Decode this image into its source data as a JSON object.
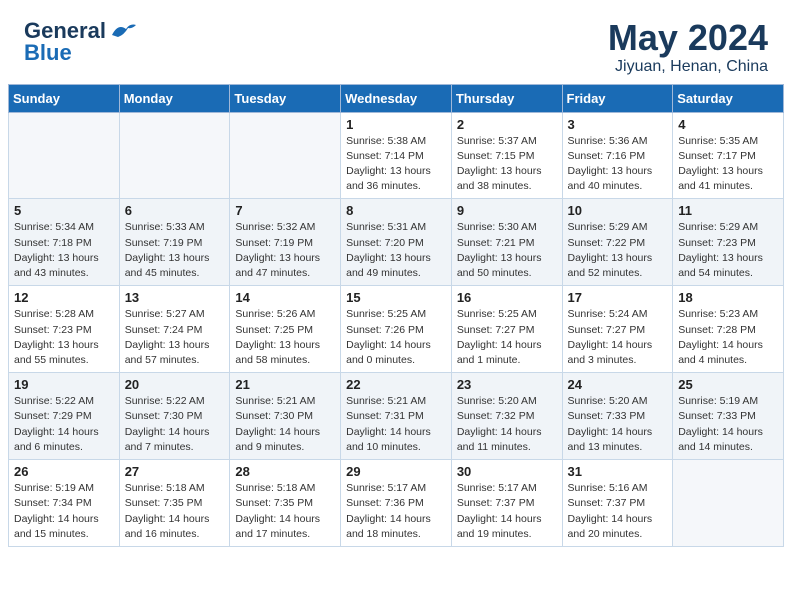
{
  "header": {
    "logo_general": "General",
    "logo_blue": "Blue",
    "title": "May 2024",
    "subtitle": "Jiyuan, Henan, China"
  },
  "days_of_week": [
    "Sunday",
    "Monday",
    "Tuesday",
    "Wednesday",
    "Thursday",
    "Friday",
    "Saturday"
  ],
  "weeks": [
    [
      {
        "day": "",
        "info": ""
      },
      {
        "day": "",
        "info": ""
      },
      {
        "day": "",
        "info": ""
      },
      {
        "day": "1",
        "info": "Sunrise: 5:38 AM\nSunset: 7:14 PM\nDaylight: 13 hours\nand 36 minutes."
      },
      {
        "day": "2",
        "info": "Sunrise: 5:37 AM\nSunset: 7:15 PM\nDaylight: 13 hours\nand 38 minutes."
      },
      {
        "day": "3",
        "info": "Sunrise: 5:36 AM\nSunset: 7:16 PM\nDaylight: 13 hours\nand 40 minutes."
      },
      {
        "day": "4",
        "info": "Sunrise: 5:35 AM\nSunset: 7:17 PM\nDaylight: 13 hours\nand 41 minutes."
      }
    ],
    [
      {
        "day": "5",
        "info": "Sunrise: 5:34 AM\nSunset: 7:18 PM\nDaylight: 13 hours\nand 43 minutes."
      },
      {
        "day": "6",
        "info": "Sunrise: 5:33 AM\nSunset: 7:19 PM\nDaylight: 13 hours\nand 45 minutes."
      },
      {
        "day": "7",
        "info": "Sunrise: 5:32 AM\nSunset: 7:19 PM\nDaylight: 13 hours\nand 47 minutes."
      },
      {
        "day": "8",
        "info": "Sunrise: 5:31 AM\nSunset: 7:20 PM\nDaylight: 13 hours\nand 49 minutes."
      },
      {
        "day": "9",
        "info": "Sunrise: 5:30 AM\nSunset: 7:21 PM\nDaylight: 13 hours\nand 50 minutes."
      },
      {
        "day": "10",
        "info": "Sunrise: 5:29 AM\nSunset: 7:22 PM\nDaylight: 13 hours\nand 52 minutes."
      },
      {
        "day": "11",
        "info": "Sunrise: 5:29 AM\nSunset: 7:23 PM\nDaylight: 13 hours\nand 54 minutes."
      }
    ],
    [
      {
        "day": "12",
        "info": "Sunrise: 5:28 AM\nSunset: 7:23 PM\nDaylight: 13 hours\nand 55 minutes."
      },
      {
        "day": "13",
        "info": "Sunrise: 5:27 AM\nSunset: 7:24 PM\nDaylight: 13 hours\nand 57 minutes."
      },
      {
        "day": "14",
        "info": "Sunrise: 5:26 AM\nSunset: 7:25 PM\nDaylight: 13 hours\nand 58 minutes."
      },
      {
        "day": "15",
        "info": "Sunrise: 5:25 AM\nSunset: 7:26 PM\nDaylight: 14 hours\nand 0 minutes."
      },
      {
        "day": "16",
        "info": "Sunrise: 5:25 AM\nSunset: 7:27 PM\nDaylight: 14 hours\nand 1 minute."
      },
      {
        "day": "17",
        "info": "Sunrise: 5:24 AM\nSunset: 7:27 PM\nDaylight: 14 hours\nand 3 minutes."
      },
      {
        "day": "18",
        "info": "Sunrise: 5:23 AM\nSunset: 7:28 PM\nDaylight: 14 hours\nand 4 minutes."
      }
    ],
    [
      {
        "day": "19",
        "info": "Sunrise: 5:22 AM\nSunset: 7:29 PM\nDaylight: 14 hours\nand 6 minutes."
      },
      {
        "day": "20",
        "info": "Sunrise: 5:22 AM\nSunset: 7:30 PM\nDaylight: 14 hours\nand 7 minutes."
      },
      {
        "day": "21",
        "info": "Sunrise: 5:21 AM\nSunset: 7:30 PM\nDaylight: 14 hours\nand 9 minutes."
      },
      {
        "day": "22",
        "info": "Sunrise: 5:21 AM\nSunset: 7:31 PM\nDaylight: 14 hours\nand 10 minutes."
      },
      {
        "day": "23",
        "info": "Sunrise: 5:20 AM\nSunset: 7:32 PM\nDaylight: 14 hours\nand 11 minutes."
      },
      {
        "day": "24",
        "info": "Sunrise: 5:20 AM\nSunset: 7:33 PM\nDaylight: 14 hours\nand 13 minutes."
      },
      {
        "day": "25",
        "info": "Sunrise: 5:19 AM\nSunset: 7:33 PM\nDaylight: 14 hours\nand 14 minutes."
      }
    ],
    [
      {
        "day": "26",
        "info": "Sunrise: 5:19 AM\nSunset: 7:34 PM\nDaylight: 14 hours\nand 15 minutes."
      },
      {
        "day": "27",
        "info": "Sunrise: 5:18 AM\nSunset: 7:35 PM\nDaylight: 14 hours\nand 16 minutes."
      },
      {
        "day": "28",
        "info": "Sunrise: 5:18 AM\nSunset: 7:35 PM\nDaylight: 14 hours\nand 17 minutes."
      },
      {
        "day": "29",
        "info": "Sunrise: 5:17 AM\nSunset: 7:36 PM\nDaylight: 14 hours\nand 18 minutes."
      },
      {
        "day": "30",
        "info": "Sunrise: 5:17 AM\nSunset: 7:37 PM\nDaylight: 14 hours\nand 19 minutes."
      },
      {
        "day": "31",
        "info": "Sunrise: 5:16 AM\nSunset: 7:37 PM\nDaylight: 14 hours\nand 20 minutes."
      },
      {
        "day": "",
        "info": ""
      }
    ]
  ]
}
